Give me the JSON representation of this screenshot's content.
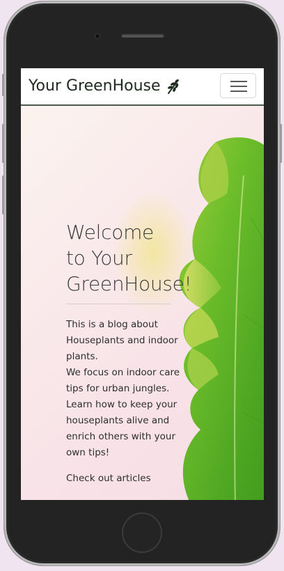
{
  "navbar": {
    "brand": "Your GreenHouse",
    "brand_icon": "leaf-icon",
    "menu_icon": "hamburger-menu-icon"
  },
  "hero": {
    "title_lines": [
      "Welcome",
      "to Your",
      "GreenHouse!"
    ],
    "description": [
      "This is a blog about Houseplants and indoor plants.",
      "We focus on indoor care tips for urban jungles.",
      "Learn how to keep your houseplants alive and enrich others with your own tips!"
    ],
    "cta": "Check out articles"
  },
  "colors": {
    "page_background": "#f1e4f1",
    "navbar_border": "#4c5a4c",
    "brand_text": "#1f2a1f",
    "leaf_green": "#5fb52a"
  }
}
